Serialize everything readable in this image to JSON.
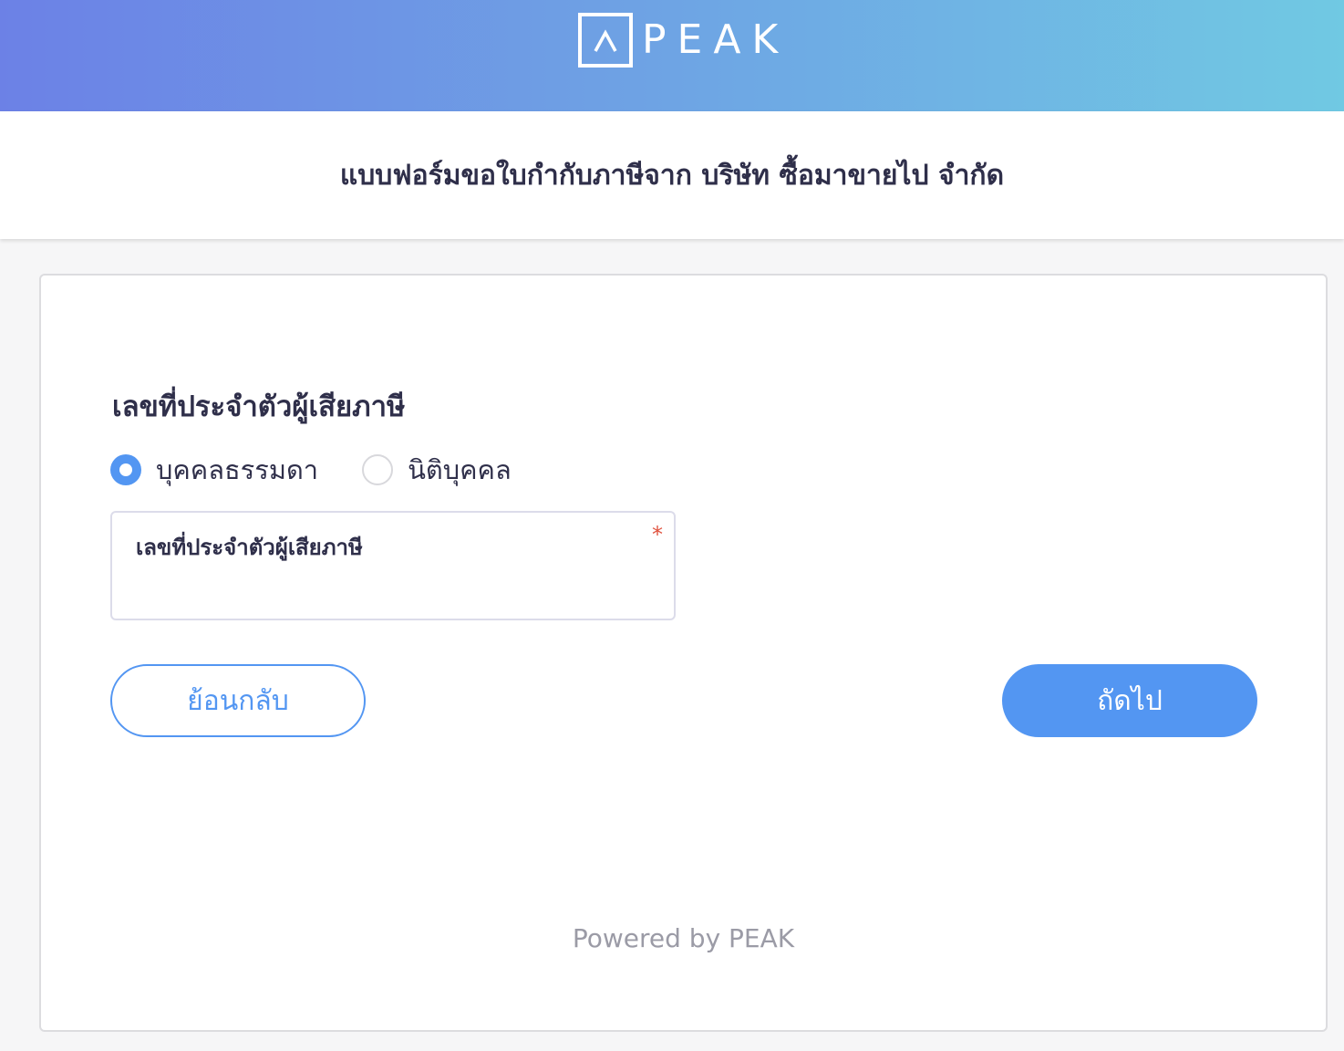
{
  "header": {
    "logo_text": "PEAK",
    "brand_gradient": [
      "#6c81e6",
      "#70c9e3"
    ]
  },
  "title": "แบบฟอร์มขอใบกำกับภาษีจาก บริษัท ซื้อมาขายไป จำกัด",
  "form": {
    "section_title": "เลขที่ประจำตัวผู้เสียภาษี",
    "radio_options": [
      {
        "label": "บุคคลธรรมดา",
        "checked": true
      },
      {
        "label": "นิติบุคคล",
        "checked": false
      }
    ],
    "tax_id_field": {
      "label": "เลขที่ประจำตัวผู้เสียภาษี",
      "required_mark": "*",
      "value": ""
    },
    "back_button": "ย้อนกลับ",
    "next_button": "ถัดไป"
  },
  "footer": {
    "powered_by": "Powered by PEAK"
  },
  "colors": {
    "accent": "#5396f2",
    "required": "#e0533f"
  }
}
